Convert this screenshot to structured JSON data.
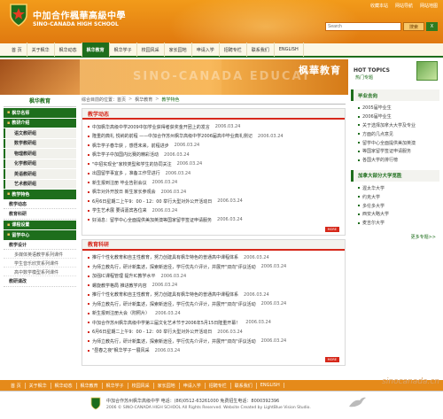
{
  "header": {
    "school_name_cn": "中加合作楓華高級中學",
    "school_name_en": "SINO-CANADA HIGH SCHOOL",
    "top_links": [
      "收藏本站",
      "网站导航",
      "网站地图"
    ],
    "search_placeholder": "Search",
    "search_button": "搜索",
    "search_close": "X"
  },
  "nav": {
    "items": [
      "首 页",
      "关于枫华",
      "枫华动态",
      "枫华教育",
      "枫华学子",
      "校园风采",
      "家长园地",
      "申请入学",
      "招聘专栏",
      "联系我们",
      "ENGLISH"
    ],
    "active_index": 3
  },
  "banner": {
    "watermark": "SINO-CANADA EDUCAT",
    "title": "枫華教育"
  },
  "hot_topics": {
    "title_en": "HOT TOPICS",
    "title_cn": "热门专题"
  },
  "left_sidebar": {
    "heading": "枫华教育",
    "menu": [
      {
        "label": "枫华名师",
        "type": "group"
      },
      {
        "label": "教研介绍",
        "type": "group"
      },
      {
        "label": "语文教研组",
        "type": "sub"
      },
      {
        "label": "数学教研组",
        "type": "sub"
      },
      {
        "label": "物理教研组",
        "type": "sub"
      },
      {
        "label": "化学教研组",
        "type": "sub"
      },
      {
        "label": "英语教研组",
        "type": "sub"
      },
      {
        "label": "艺术教研组",
        "type": "sub"
      },
      {
        "label": "教学特色",
        "type": "group"
      },
      {
        "label": "教学动态",
        "type": "plain"
      },
      {
        "label": "教育科研",
        "type": "plain"
      },
      {
        "label": "课程设置",
        "type": "group"
      },
      {
        "label": "留学中心",
        "type": "group"
      },
      {
        "label": "教学设计",
        "type": "plain"
      },
      {
        "label": "多媒体英语教学系列课件",
        "type": "sub2"
      },
      {
        "label": "学生音乐欣赏系列课件",
        "type": "sub2"
      },
      {
        "label": "高中数学模型系列课件",
        "type": "sub2"
      },
      {
        "label": "教研课改",
        "type": "plain"
      }
    ]
  },
  "breadcrumb": {
    "prefix": "综合目前的位置：",
    "items": [
      "首页",
      "枫华教育",
      "教学特色"
    ]
  },
  "teaching_news": {
    "title": "教学动态",
    "items": [
      {
        "title": "中加枫华高级中学2009中加学业获得者获奖金开团上的发言",
        "date": "2006.03.24"
      },
      {
        "title": "隆重的典礼 悦纳的前程 ——中加合作苏州枫华高级中学2006届高中毕业典礼侧记",
        "date": "2006.03.24"
      },
      {
        "title": "枫华学子春华获 ，感悟未来，前程进步",
        "date": "2006.03.24"
      },
      {
        "title": "枫华学子中加国内比赛的精彩活动",
        "date": "2006.03.24"
      },
      {
        "title": "\"中招实现全\"家校类型和学生的协同关注",
        "date": "2006.03.24"
      },
      {
        "title": "出国留学事宜多 ，准备工作早进行",
        "date": "2006.03.24"
      },
      {
        "title": "新生报到注册 毕业告别会议",
        "date": "2006.03.24"
      },
      {
        "title": "枫华对外开放日 新生家长参观会",
        "date": "2006.03.24"
      },
      {
        "title": "6月6日星期二上午9：00 - 12：00 举行大型对外公开活动日",
        "date": "2006.03.24"
      },
      {
        "title": "学生艺术展 要请嘉宾各位来",
        "date": "2006.03.24"
      },
      {
        "title": "好消息：留学中心全面提供美加英澳等国家留学签证申请服务",
        "date": "2006.03.24"
      }
    ],
    "more": "MORE"
  },
  "research": {
    "title": "教育科研",
    "items": [
      {
        "title": "推行个性化教育和自主性教育，努力创建具有枫华特色的普通高中课程体系",
        "date": "2006.03.24"
      },
      {
        "title": "为师立教先行，研计新集述，探索新途径，学行优先介评计，并展开\"双向\"评议活动",
        "date": "2006.03.24"
      },
      {
        "title": "加强IC课程管理 提升IC教学水平",
        "date": "2006.03.24"
      },
      {
        "title": "螺旋教学格局 推进教学内容",
        "date": "2006.03.24"
      },
      {
        "title": "推行个性化教育和自主性教育，努力创建具有枫华特色的普通高中课程体系",
        "date": "2006.03.24"
      },
      {
        "title": "为师立教先行，研计新集述，探索新途径，学行优先介评计，并展开\"双向\"评议活动",
        "date": "2006.03.24"
      },
      {
        "title": "新生报到注册大会（附照片）",
        "date": "2006.03.24"
      },
      {
        "title": "中加合作苏州枫华高级中学第三届文化艺术节于2006年5月15日隆重开幕！",
        "date": "2006.03.24"
      },
      {
        "title": "6月6日星期二上午9：00 - 12：00 举行大型对外公开活动日",
        "date": "2006.03.24"
      },
      {
        "title": "为师立教先行，研计新集述，探索新途径，学行优先介评计，并展开\"双向\"评议活动",
        "date": "2006.03.24"
      },
      {
        "title": "\"昼春之夜\"枫华学子一展风采",
        "date": "2006.03.24"
      }
    ],
    "more": "MORE"
  },
  "right_sidebar": {
    "graduates_title": "毕业去向",
    "graduates": [
      "2005届毕业生",
      "2006届毕业生",
      "关于选择加拿大大学及专业",
      "方面的几点意见",
      "留学中心全面提供美加英澳",
      "等国家留学签证申请服务",
      "各国大学的排行榜"
    ],
    "universities_title": "加拿大部分大学览胜",
    "universities": [
      "渥太华大学",
      "约克大学",
      "多伦多大学",
      "西安大略大学",
      "麦吉尔大学"
    ],
    "more": "更多专题>>"
  },
  "footer_nav": {
    "items": [
      "首 页",
      "关于枫华",
      "枫华动态",
      "枫华教育",
      "枫华学子",
      "校园风采",
      "家长园地",
      "申请入学",
      "招聘专栏",
      "联系我们",
      "ENGLISH"
    ],
    "domain": "sinocanada.cn"
  },
  "footer": {
    "line1": "中加合作苏州枫华高级中学  电话：(86)0512-63261000  免费招生电话：8000392396",
    "line2": "2006 © SINO-CANADA HIGH SCHOOL All Rights Reserved.  Website Created by LightBlue Vision Studio."
  },
  "colors": {
    "orange": "#e58a1a",
    "green": "#1e6e1c",
    "red": "#d6281a"
  }
}
